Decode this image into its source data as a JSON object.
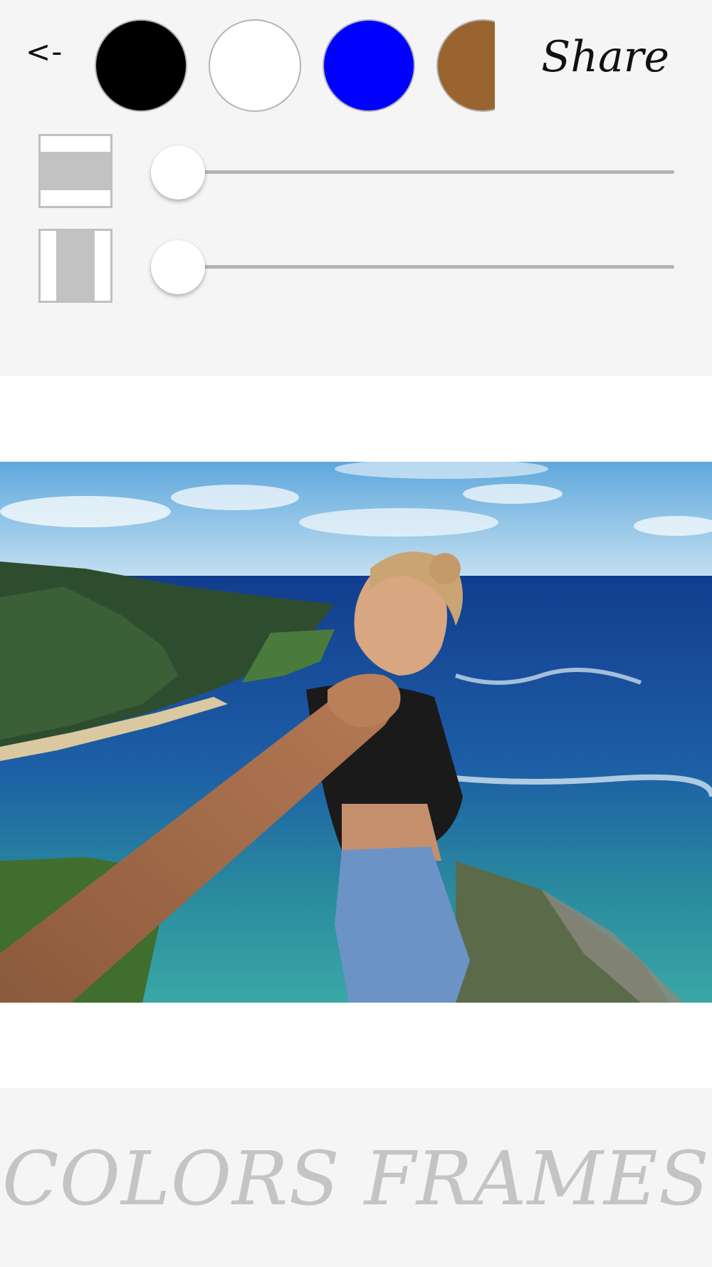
{
  "toolbar": {
    "back_label": "<-",
    "share_label": "Share",
    "swatches": [
      {
        "name": "black",
        "color": "#000000"
      },
      {
        "name": "white",
        "color": "#ffffff"
      },
      {
        "name": "blue",
        "color": "#0000ff"
      },
      {
        "name": "brown",
        "color": "#9a6430"
      }
    ],
    "controls": [
      {
        "icon": "horizontal-frame-icon",
        "slider_value": 0
      },
      {
        "icon": "vertical-frame-icon",
        "slider_value": 0
      }
    ]
  },
  "canvas": {
    "background": "#ffffff",
    "photo_subject": "photo"
  },
  "brand": {
    "title": "COLORS FRAMES"
  }
}
